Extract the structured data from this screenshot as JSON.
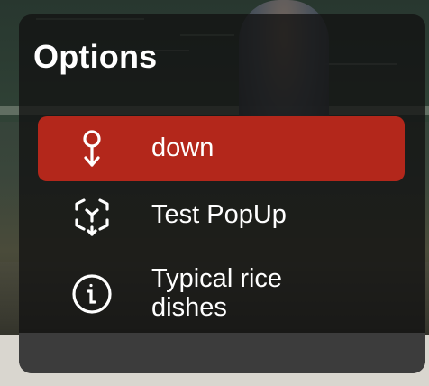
{
  "panel": {
    "title": "Options",
    "items": [
      {
        "label": "down",
        "icon": "location-pin-down-icon",
        "active": true
      },
      {
        "label": "Test PopUp",
        "icon": "focus-frame-icon",
        "active": false
      },
      {
        "label": "Typical rice dishes",
        "icon": "info-circle-icon",
        "active": false
      }
    ]
  },
  "colors": {
    "active_item_background": "#b3271b",
    "panel_background": "#121212",
    "footer_background": "#3c3c3c",
    "text": "#ffffff"
  }
}
